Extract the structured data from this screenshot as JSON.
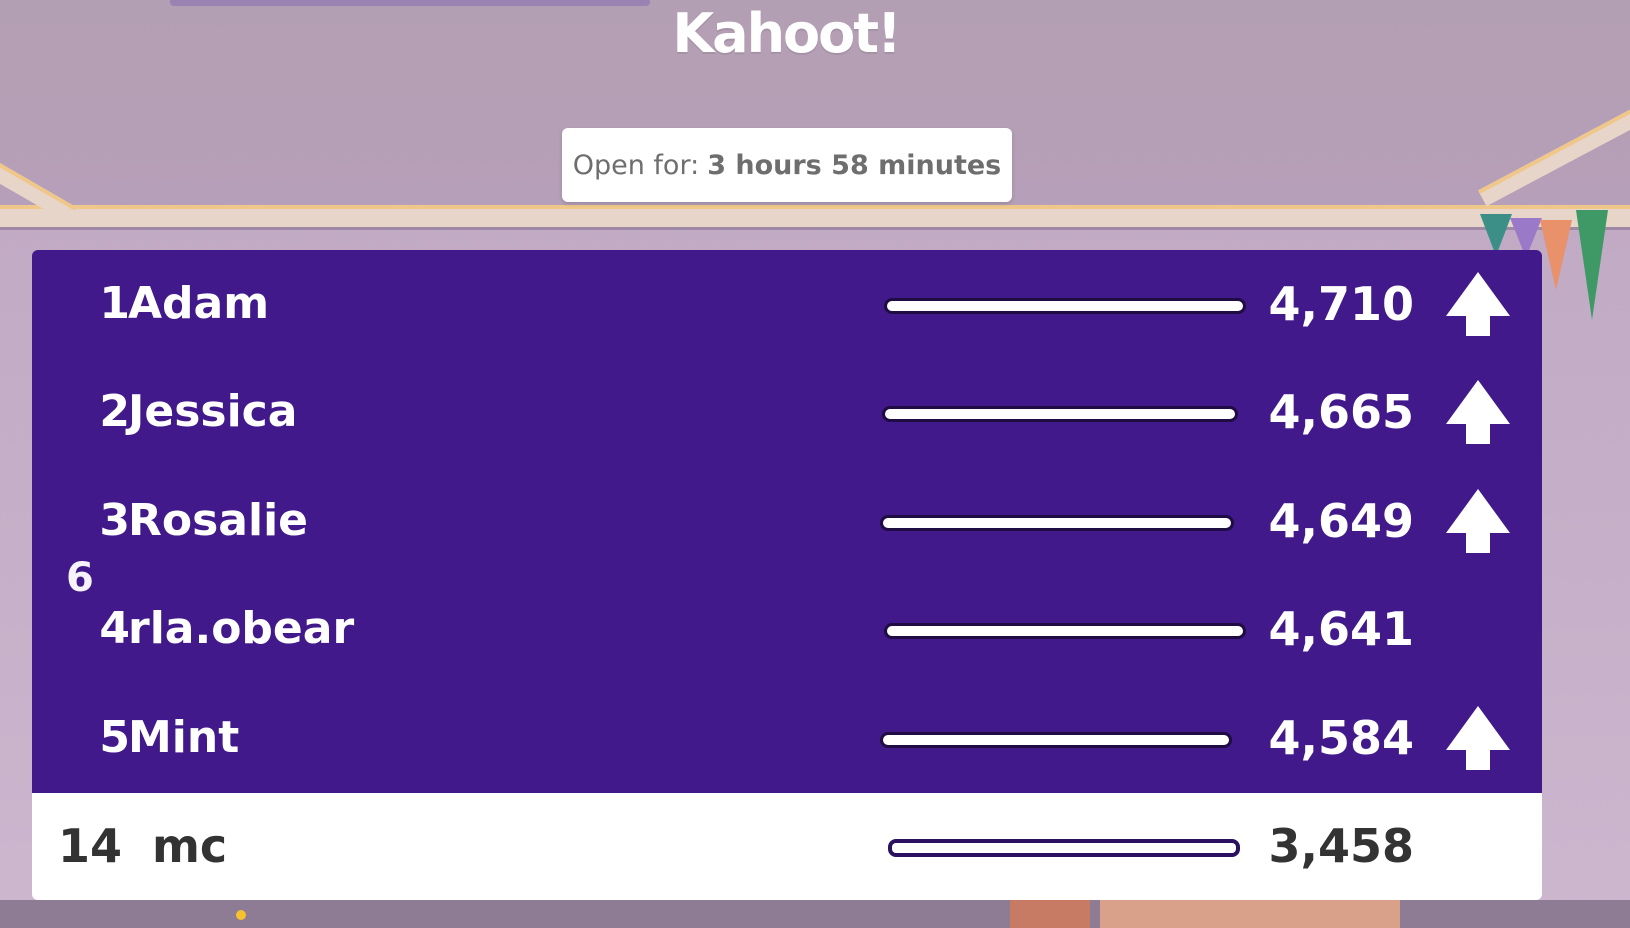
{
  "logo": "Kahoot!",
  "timer": {
    "label": "Open for:",
    "value": "3 hours 58 minutes"
  },
  "leaderboard": [
    {
      "rank": "1",
      "name": "Adam",
      "score": "4,710",
      "trend": "up"
    },
    {
      "rank": "2",
      "name": "Jessica",
      "score": "4,665",
      "trend": "up"
    },
    {
      "rank": "3",
      "name": "Rosalie",
      "score": "4,649",
      "trend": "up"
    },
    {
      "rank": "4",
      "name": "rla.obear",
      "score": "4,641",
      "trend": "none"
    },
    {
      "rank": "5",
      "name": "Mint",
      "score": "4,584",
      "trend": "up"
    }
  ],
  "ghost_rank": "6",
  "self": {
    "rank": "14",
    "name": "mc",
    "score": "3,458"
  },
  "colors": {
    "board": "#41198b",
    "self_row": "#ffffff",
    "background": "#b9a3bb"
  },
  "icons": {
    "trend_up": "arrow-up-icon"
  }
}
